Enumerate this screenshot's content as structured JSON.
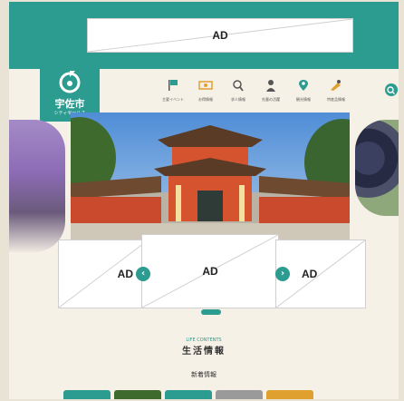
{
  "ads": {
    "top": "AD",
    "left": "AD",
    "center": "AD",
    "right": "AD"
  },
  "logo": {
    "title": "宇佐市",
    "subtitle": "シティセールス"
  },
  "nav": [
    {
      "label": "主要イベント",
      "icon": "flag-icon",
      "color": "#2c9b90"
    },
    {
      "label": "お得情報",
      "icon": "ticket-icon",
      "color": "#e0a030"
    },
    {
      "label": "求人情報",
      "icon": "magnifier-icon",
      "color": "#555555"
    },
    {
      "label": "先輩の活躍",
      "icon": "person-icon",
      "color": "#555555"
    },
    {
      "label": "観光情報",
      "icon": "map-pin-icon",
      "color": "#2c9b90"
    },
    {
      "label": "特産品情報",
      "icon": "food-icon",
      "color": "#e0a030"
    }
  ],
  "carousel": {
    "active_dot": "●●●"
  },
  "life": {
    "en": "LIFE CONTENTS",
    "title": "生活情報",
    "new_info": "新着情報"
  },
  "colors": {
    "teal": "#2c9b90",
    "beige": "#f6f1e6"
  }
}
